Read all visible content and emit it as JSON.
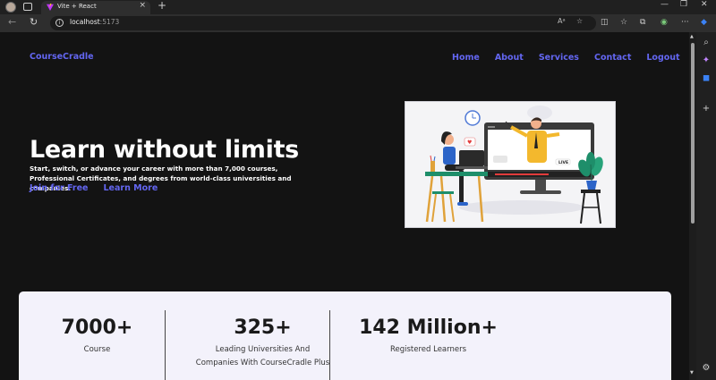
{
  "browser": {
    "tab_title": "Vite + React",
    "url_host": "localhost",
    "url_port": ":5173"
  },
  "header": {
    "brand": "CourseCradle",
    "nav": [
      "Home",
      "About",
      "Services",
      "Contact",
      "Logout"
    ]
  },
  "hero": {
    "title": "Learn without limits",
    "subtitle": "Start, switch, or advance your career with more than 7,000 courses, Professional Certificates, and degrees from world-class universities and companies.",
    "cta_primary": "Join for Free",
    "cta_secondary": "Learn More"
  },
  "illustration": {
    "live_badge": "LIVE",
    "icon": "online-teaching-illustration"
  },
  "stats": [
    {
      "value": "7000+",
      "label": "Course"
    },
    {
      "value": "325+",
      "label": "Leading Universities And Companies With CourseCradle Plus"
    },
    {
      "value": "142 Million+",
      "label": "Registered Learners"
    }
  ],
  "colors": {
    "accent": "#6366f1",
    "page_bg": "#131313",
    "stats_bg": "#f3f2fb"
  }
}
